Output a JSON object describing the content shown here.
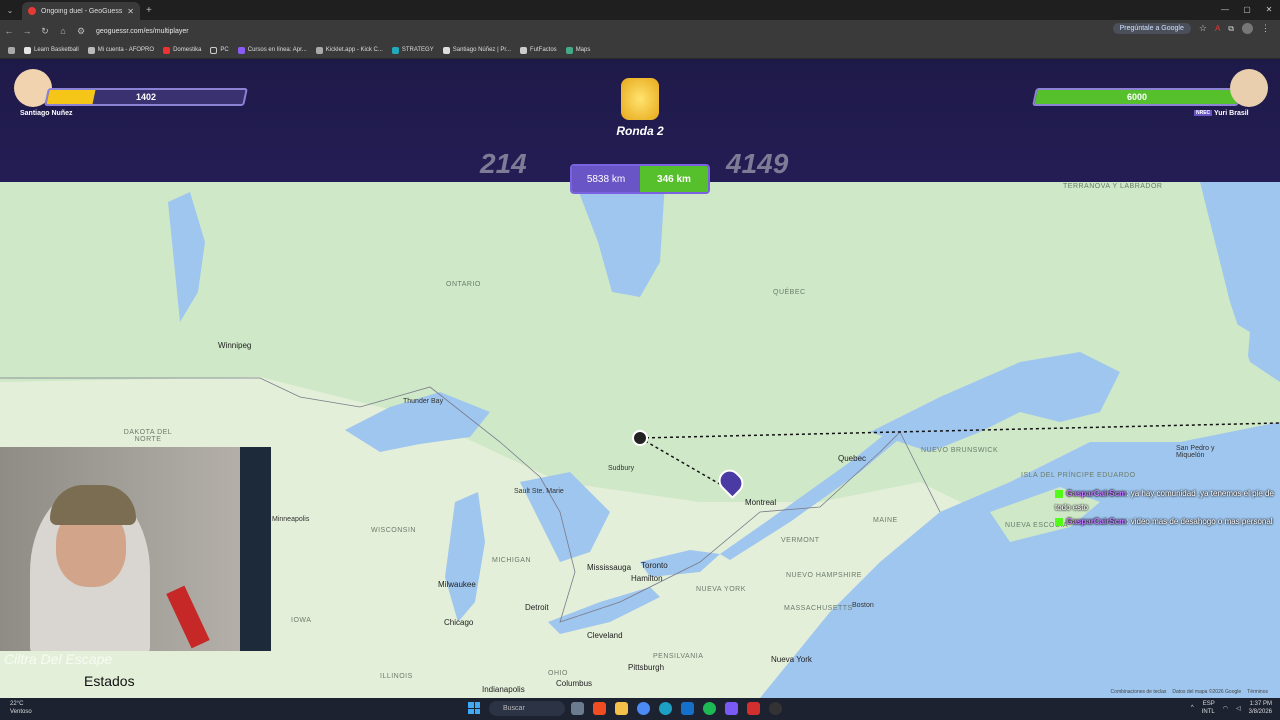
{
  "browser": {
    "tab_title": "Ongoing duel - GeoGuessr",
    "url": "geoguessr.com/es/multiplayer",
    "google_button": "Pregúntale a Google",
    "bookmarks": [
      "Learn Basketball",
      "Mi cuenta - AFOPRO",
      "Domestika",
      "PC",
      "Cursos en línea: Apr...",
      "Kicklet.app - Kick C...",
      "STRATEGY",
      "Santiago Núñez | Pr...",
      "FutFactos",
      "Maps"
    ]
  },
  "game": {
    "player_left": {
      "name": "Santiago Nuñez",
      "hp": "1402",
      "hp_fraction": 0.234
    },
    "player_right": {
      "name": "Yuri Brasil",
      "tag": "NREC",
      "hp": "6000",
      "hp_fraction": 1.0
    },
    "round": "Ronda 2",
    "score_left": "214",
    "score_right": "4149",
    "distance_left": "5838 km",
    "distance_right": "346 km"
  },
  "map": {
    "regions": [
      "ONTARIO",
      "QUÉBEC",
      "DAKOTA DEL NORTE",
      "WISCONSIN",
      "MICHIGAN",
      "IOWA",
      "ILLINOIS",
      "OHIO",
      "PENSILVANIA",
      "NUEVA YORK",
      "VERMONT",
      "MAINE",
      "NUEVO HAMPSHIRE",
      "MASSACHUSETTS",
      "NUEVA ESCOCIA",
      "NUEVO BRUNSWICK",
      "ISLA DEL PRÍNCIPE EDUARDO",
      "TERRANOVA Y LABRADOR"
    ],
    "cities": [
      "Winnipeg",
      "Thunder Bay",
      "Sault Ste. Marie",
      "Sudbury",
      "Montreal",
      "Quebec",
      "Mississauga",
      "Hamilton",
      "Toronto",
      "Milwaukee",
      "Chicago",
      "Detroit",
      "Cleveland",
      "Pittsburgh",
      "Columbus",
      "Indianapolis",
      "Nueva York",
      "Boston",
      "San Pedro y Miquelón",
      "Minneapolis"
    ],
    "attribution": [
      "Combinaciones de teclas",
      "Datos del mapa ©2026 Google",
      "Términos"
    ]
  },
  "overlay": {
    "watermark": "Ciltra Del Escape",
    "estados_label": "Estados",
    "chat": [
      {
        "user": "GasparCairScm",
        "message": "ya hay comunidad ,ya tenemos el pie de todo esto"
      },
      {
        "user": "GasparCairScm",
        "message": "video mas de desahogo o mas personal"
      }
    ]
  },
  "taskbar": {
    "weather_temp": "22°C",
    "weather_desc": "Ventoso",
    "search_placeholder": "Buscar",
    "lang": "ESP",
    "lang2": "INTL",
    "time": "1:37 PM",
    "date": "3/8/2026"
  },
  "colors": {
    "hp_left": "#f5c518",
    "hp_right": "#56c02c",
    "map_land": "#cfe8c8",
    "map_water": "#9fc6ee"
  }
}
